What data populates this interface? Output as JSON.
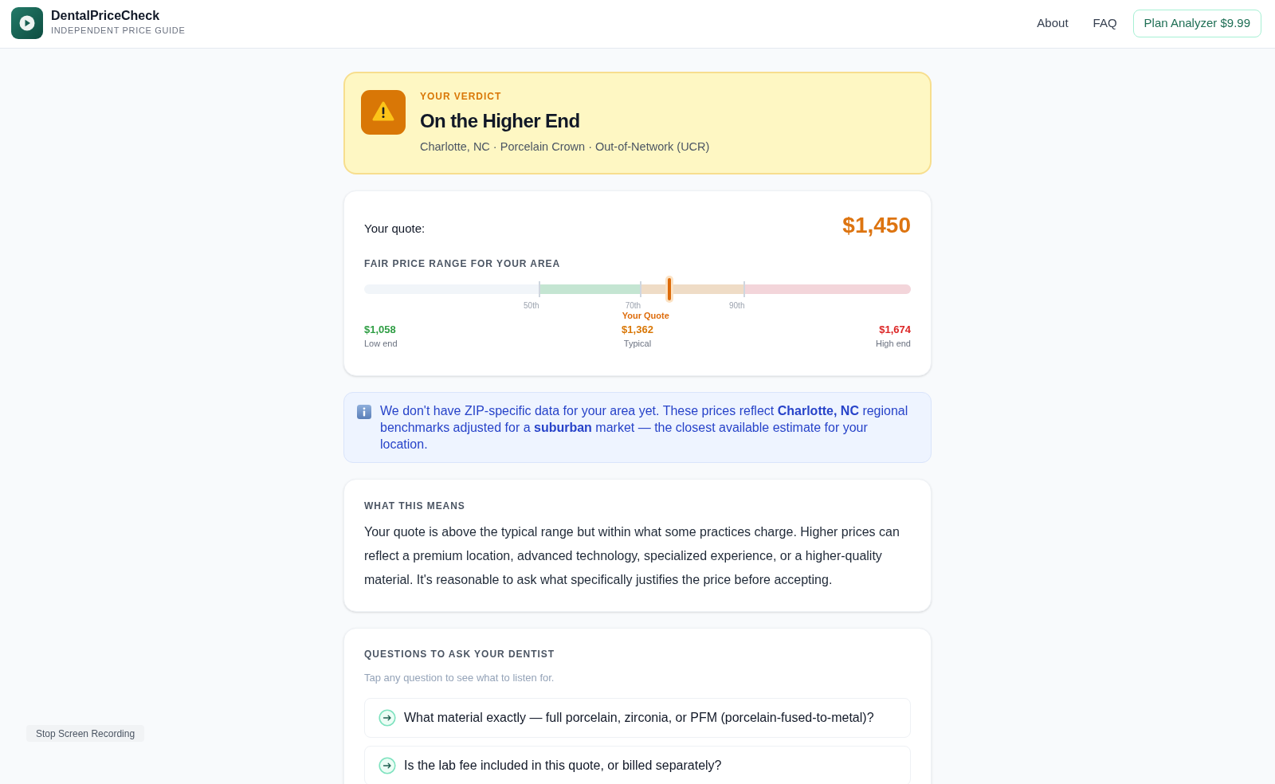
{
  "header": {
    "brand": {
      "name": "DentalPriceCheck",
      "tagline": "INDEPENDENT PRICE GUIDE"
    },
    "nav": [
      {
        "label": "About",
        "kind": "link"
      },
      {
        "label": "FAQ",
        "kind": "link"
      },
      {
        "label": "Plan Analyzer $9.99",
        "kind": "button"
      }
    ]
  },
  "verdict": {
    "label": "YOUR VERDICT",
    "title": "On the Higher End",
    "details": "Charlotte, NC · Porcelain Crown · Out-of-Network (UCR)"
  },
  "quote_card": {
    "quote_label": "Your quote:",
    "quote_value": "$1,450",
    "range_title": "FAIR PRICE RANGE FOR YOUR AREA",
    "range_bar": {
      "zones": [
        {
          "color": "#f1f5f9"
        },
        {
          "color": "#c4e5d2"
        },
        {
          "color": "#efdcc6"
        },
        {
          "color": "#f3d5da"
        }
      ],
      "ticks": [
        {
          "label": "50th",
          "level": 0.32
        },
        {
          "label": "70th",
          "level": 0.506
        },
        {
          "label": "90th",
          "level": 0.696
        }
      ],
      "marker": {
        "label": "Your Quote",
        "level": 0.558
      }
    },
    "stats": [
      {
        "value": "$1,058",
        "label": "Low end",
        "color": "#2f9e44"
      },
      {
        "value": "$1,362",
        "label": "Typical",
        "color": "#d97706"
      },
      {
        "value": "$1,674",
        "label": "High end",
        "color": "#dc2626"
      }
    ]
  },
  "notice": {
    "text": "We don't have ZIP-specific data for your area yet. These prices reflect **Charlotte, NC** regional benchmarks adjusted for a **suburban** market — the closest available estimate for your location."
  },
  "meaning": {
    "title": "WHAT THIS MEANS",
    "body": "Your quote is above the typical range but within what some practices charge. Higher prices can reflect a premium location, advanced technology, specialized experience, or a higher-quality material. It's reasonable to ask what specifically justifies the price before accepting."
  },
  "questions": {
    "title": "QUESTIONS TO ASK YOUR DENTIST",
    "hint": "Tap any question to see what to listen for.",
    "items": [
      {
        "text": "What material exactly — full porcelain, zirconia, or PFM (porcelain-fused-to-metal)?"
      },
      {
        "text": "Is the lab fee included in this quote, or billed separately?"
      }
    ]
  },
  "overlay_button": {
    "label": "Stop Screen Recording"
  }
}
